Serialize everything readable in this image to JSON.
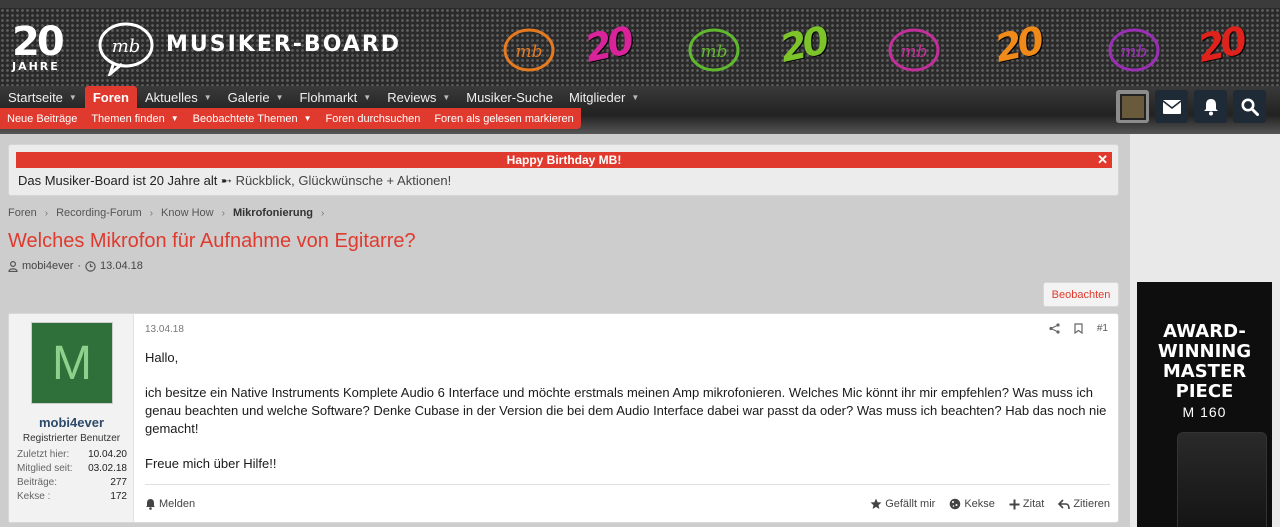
{
  "header": {
    "logo_number": "20",
    "logo_sub": "JAHRE",
    "brand": "MUSIKER-BOARD",
    "deco_number": "20"
  },
  "nav": {
    "items": [
      {
        "label": "Startseite"
      },
      {
        "label": "Foren"
      },
      {
        "label": "Aktuelles"
      },
      {
        "label": "Galerie"
      },
      {
        "label": "Flohmarkt"
      },
      {
        "label": "Reviews"
      },
      {
        "label": "Musiker-Suche"
      },
      {
        "label": "Mitglieder"
      }
    ],
    "sub": [
      {
        "label": "Neue Beiträge"
      },
      {
        "label": "Themen finden"
      },
      {
        "label": "Beobachtete Themen"
      },
      {
        "label": "Foren durchsuchen"
      },
      {
        "label": "Foren als gelesen markieren"
      }
    ]
  },
  "notice": {
    "title": "Happy Birthday MB!",
    "close": "✕",
    "text": "Das Musiker-Board ist 20 Jahre alt",
    "link": "Rückblick, Glückwünsche + Aktionen!"
  },
  "breadcrumb": [
    "Foren",
    "Recording-Forum",
    "Know How",
    "Mikrofonierung"
  ],
  "thread": {
    "title": "Welches Mikrofon für Aufnahme von Egitarre?",
    "author": "mobi4ever",
    "date": "13.04.18",
    "watch_label": "Beobachten"
  },
  "post": {
    "avatar_letter": "M",
    "username": "mobi4ever",
    "user_title": "Registrierter Benutzer",
    "stats": [
      {
        "k": "Zuletzt hier:",
        "v": "10.04.20"
      },
      {
        "k": "Mitglied seit:",
        "v": "03.02.18"
      },
      {
        "k": "Beiträge:",
        "v": "277"
      },
      {
        "k": "Kekse :",
        "v": "172"
      }
    ],
    "date": "13.04.18",
    "number": "#1",
    "body": [
      "Hallo,",
      "ich besitze ein Native Instruments Komplete Audio 6 Interface und möchte erstmals meinen Amp mikrofonieren. Welches Mic könnt ihr mir empfehlen? Was muss ich genau beachten und welche Software? Denke Cubase in der Version die bei dem Audio Interface dabei war passt da oder? Was muss ich beachten? Hab das noch nie gemacht!",
      "Freue mich über Hilfe!!"
    ],
    "report": "Melden",
    "actions": [
      {
        "label": "Gefällt mir"
      },
      {
        "label": "Kekse"
      },
      {
        "label": "Zitat"
      },
      {
        "label": "Zitieren"
      }
    ]
  },
  "ad": {
    "headline_1": "AWARD-",
    "headline_2": "WINNING",
    "headline_3": "MASTER",
    "headline_4": "PIECE",
    "model": "M 160"
  },
  "colors": {
    "accent": "#e03a2e",
    "header": "#2a2a2a",
    "username": "#2e4a6a"
  }
}
